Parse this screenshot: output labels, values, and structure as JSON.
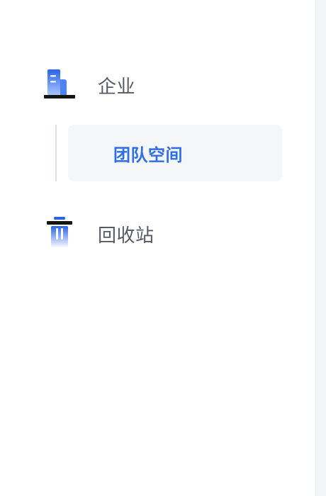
{
  "sidebar": {
    "items": [
      {
        "label": "企业",
        "icon": "building-icon"
      },
      {
        "label": "回收站",
        "icon": "trash-icon"
      }
    ],
    "subitems": [
      {
        "label": "团队空间",
        "active": true
      }
    ]
  },
  "colors": {
    "accent": "#2f6fe6",
    "text": "#555a63",
    "active_bg": "#f5f6f7",
    "tree_line": "#dcdfe5"
  }
}
